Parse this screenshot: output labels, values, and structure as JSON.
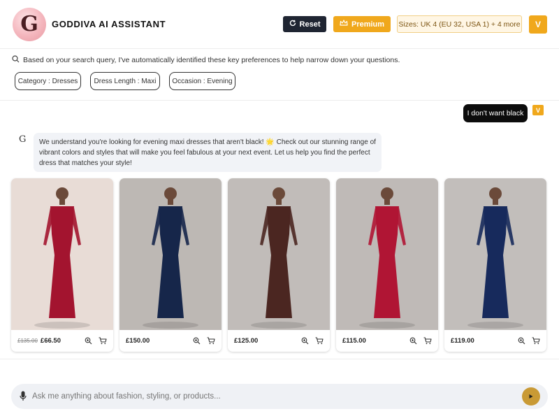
{
  "header": {
    "logo_letter": "G",
    "title": "GODDIVA AI ASSISTANT",
    "reset_label": "Reset",
    "premium_label": "Premium",
    "sizes_label": "Sizes: UK 4 (EU 32, USA 1) + 4 more",
    "user_initial": "V"
  },
  "preferences": {
    "note": "Based on your search query, I've automatically identified these key preferences to help narrow down your questions.",
    "chips": [
      "Category : Dresses",
      "Dress Length : Maxi",
      "Occasion : Evening"
    ]
  },
  "chat": {
    "user_message": "I don't want black",
    "user_initial": "V",
    "bot_icon": "G",
    "bot_message": "We understand you're looking for evening maxi dresses that aren't black! 🌟 Check out our stunning range of vibrant colors and styles that will make you feel fabulous at your next event. Let us help you find the perfect dress that matches your style!"
  },
  "products": [
    {
      "old_price": "£135.00",
      "price": "£66.50",
      "dress_color": "#a3142f",
      "bg": "#e8dcd6"
    },
    {
      "old_price": "",
      "price": "£150.00",
      "dress_color": "#16264a",
      "bg": "#bdb8b4"
    },
    {
      "old_price": "",
      "price": "£125.00",
      "dress_color": "#4b2621",
      "bg": "#c1bcb9"
    },
    {
      "old_price": "",
      "price": "£115.00",
      "dress_color": "#b01534",
      "bg": "#bfbab7"
    },
    {
      "old_price": "",
      "price": "£119.00",
      "dress_color": "#172a5c",
      "bg": "#c2bebb"
    }
  ],
  "input": {
    "placeholder": "Ask me anything about fashion, styling, or products..."
  },
  "colors": {
    "accent": "#f0a81c",
    "dark": "#1f2532",
    "send": "#c99a35"
  }
}
